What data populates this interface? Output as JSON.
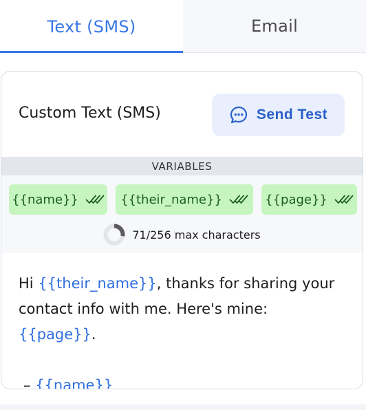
{
  "tabs": {
    "sms_label": "Text (SMS)",
    "email_label": "Email"
  },
  "card": {
    "title": "Custom Text (SMS)",
    "send_test_label": "Send Test"
  },
  "variables": {
    "header": "VARIABLES",
    "chips": [
      "{{name}}",
      "{{their_name}}",
      "{{page}}"
    ],
    "counter_text": "71/256 max characters",
    "used_fraction": 0.277
  },
  "message": {
    "greeting": "Hi ",
    "var_their_name": "{{their_name}}",
    "text_1": ", thanks for sharing your contact info with me. Here's mine: ",
    "var_page": "{{page}}",
    "text_2": ".",
    "dash": "– ",
    "var_name": "{{name}}"
  },
  "colors": {
    "accent": "#3a78e6",
    "chip_bg": "#c6f5c0",
    "chip_text": "#1b5e20",
    "variable_text": "#2f6fe0"
  },
  "icons": {
    "send_test": "chat-bubble-dots-icon",
    "chip_check": "double-check-icon",
    "counter": "progress-ring-icon"
  }
}
